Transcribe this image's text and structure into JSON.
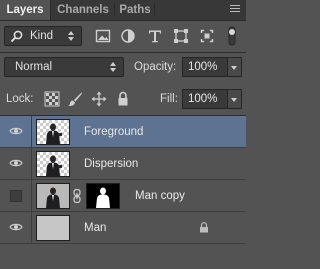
{
  "tabs": [
    {
      "label": "Layers",
      "active": true
    },
    {
      "label": "Channels",
      "active": false
    },
    {
      "label": "Paths",
      "active": false
    }
  ],
  "filter": {
    "kind_label": "Kind",
    "icons": [
      "image-filter-icon",
      "adjustment-filter-icon",
      "type-filter-icon",
      "shape-filter-icon",
      "smart-object-filter-icon"
    ]
  },
  "blend": {
    "mode": "Normal",
    "opacity_label": "Opacity:",
    "opacity_value": "100%"
  },
  "lock": {
    "label": "Lock:",
    "fill_label": "Fill:",
    "fill_value": "100%"
  },
  "layers": [
    {
      "name": "Foreground",
      "visible": true,
      "selected": true,
      "thumb": "man-transparent",
      "mask": false,
      "locked": false
    },
    {
      "name": "Dispersion",
      "visible": true,
      "selected": false,
      "thumb": "man-transparent",
      "mask": false,
      "locked": false
    },
    {
      "name": "Man copy",
      "visible": false,
      "selected": false,
      "thumb": "man-full",
      "mask": true,
      "locked": false
    },
    {
      "name": "Man",
      "visible": true,
      "selected": false,
      "thumb": "gray",
      "mask": false,
      "locked": true
    }
  ],
  "colors": {
    "panel": "#535353",
    "selected_row": "#5e7291",
    "tab_bar": "#383838"
  }
}
